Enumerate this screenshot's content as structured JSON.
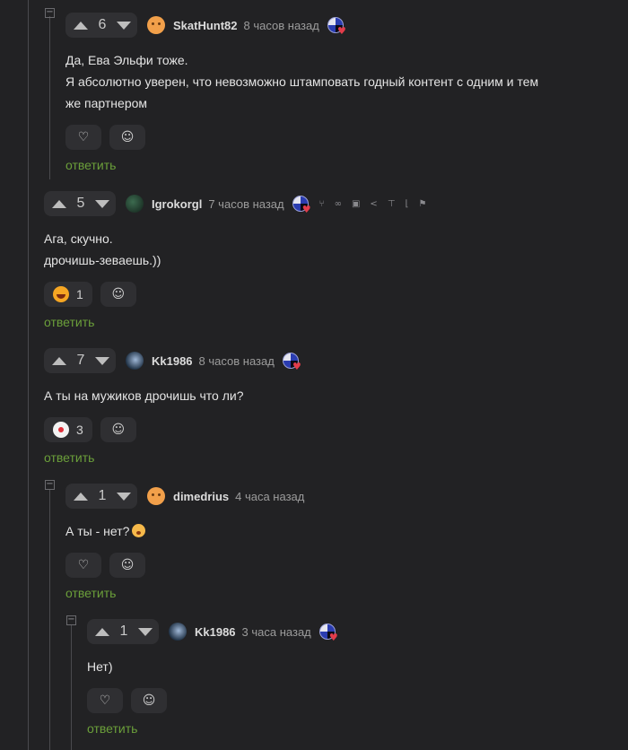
{
  "comments": [
    {
      "votes": "6",
      "username": "SkatHunt82",
      "time": "8 часов назад",
      "lines": [
        "Да, Ева Эльфи тоже.",
        "Я абсолютно уверен, что невозможно штамповать годный контент с одним и тем",
        "же партнером"
      ],
      "reaction": "heart-icon",
      "reply_label": "ответить"
    },
    {
      "votes": "5",
      "username": "Igrokorgl",
      "time": "7 часов назад",
      "lines": [
        "Ага, скучно.",
        "дрочишь-зеваешь.))"
      ],
      "reaction": "laughing-emoji",
      "reaction_count": "1",
      "reply_label": "ответить",
      "tools": [
        "branch-icon",
        "link-icon",
        "save-icon",
        "share-icon",
        "pin-icon",
        "sort-icon",
        "flag-icon"
      ]
    },
    {
      "votes": "7",
      "username": "Kk1986",
      "time": "8 часов назад",
      "lines": [
        "А ты на мужиков дрочишь что ли?"
      ],
      "reaction": "clown-emoji",
      "reaction_count": "3",
      "reply_label": "ответить"
    },
    {
      "votes": "1",
      "username": "dimedrius",
      "time": "4 часа назад",
      "lines": [
        "А ты - нет?"
      ],
      "reaction": "heart-icon",
      "reply_label": "ответить"
    },
    {
      "votes": "1",
      "username": "Kk1986",
      "time": "3 часа назад",
      "lines": [
        "Нет)"
      ],
      "reaction": "heart-icon",
      "reply_label": "ответить"
    }
  ],
  "colors": {
    "background": "#222224",
    "reply_link": "#6b9f3a",
    "button_bg": "#2f2f32"
  }
}
